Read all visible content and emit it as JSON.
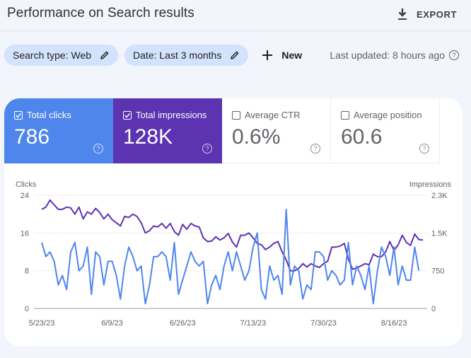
{
  "header": {
    "title": "Performance on Search results",
    "export_label": "EXPORT"
  },
  "filters": {
    "chips": [
      {
        "label": "Search type: Web"
      },
      {
        "label": "Date: Last 3 months"
      }
    ],
    "new_label": "New",
    "last_updated": "Last updated: 8 hours ago"
  },
  "metrics": [
    {
      "label": "Total clicks",
      "value": "786",
      "checked": true,
      "color": "#4f86ec"
    },
    {
      "label": "Total impressions",
      "value": "128K",
      "checked": true,
      "color": "#5c33b0"
    },
    {
      "label": "Average CTR",
      "value": "0.6%",
      "checked": false
    },
    {
      "label": "Average position",
      "value": "60.6",
      "checked": false
    }
  ],
  "chart_data": {
    "type": "line",
    "left_axis": {
      "label": "Clicks",
      "ticks": [
        "24",
        "16",
        "8",
        "0"
      ],
      "range": [
        0,
        24
      ]
    },
    "right_axis": {
      "label": "Impressions",
      "ticks": [
        "2.3K",
        "1.5K",
        "750",
        "0"
      ],
      "range": [
        0,
        2250
      ]
    },
    "x_tick_labels": [
      "5/23/23",
      "6/9/23",
      "6/26/23",
      "7/13/23",
      "7/30/23",
      "8/16/23"
    ],
    "x_start": "5/23/23",
    "tick_interval_days": 17,
    "grid": true,
    "series": [
      {
        "name": "Clicks",
        "axis": "left",
        "color": "#4f86ec",
        "values": [
          14,
          11,
          12,
          10,
          5,
          7,
          4,
          12,
          14,
          8,
          9,
          13,
          3,
          12,
          11,
          5,
          10,
          10,
          7,
          2,
          9,
          13,
          11,
          8,
          9,
          1,
          5,
          11,
          11,
          12,
          11,
          6,
          14,
          3,
          6,
          9,
          12,
          10,
          9,
          10,
          1,
          5,
          7,
          4,
          9,
          12,
          8,
          12,
          9,
          6,
          8,
          13,
          16,
          4,
          2,
          9,
          6,
          7,
          3,
          21,
          5,
          9,
          8,
          2,
          5,
          4,
          12,
          12,
          11,
          6,
          8,
          7,
          5,
          6,
          14,
          5,
          9,
          7,
          4,
          9,
          1,
          8,
          13,
          11,
          7,
          13,
          5,
          9,
          6,
          6,
          13,
          8
        ]
      },
      {
        "name": "Impressions",
        "axis": "right",
        "color": "#5c33b0",
        "values": [
          1970,
          2015,
          2155,
          2060,
          1970,
          1970,
          2015,
          2000,
          1875,
          2015,
          1780,
          1920,
          1875,
          1990,
          1905,
          1780,
          1875,
          1765,
          1705,
          1640,
          1830,
          1810,
          1875,
          1830,
          1705,
          1500,
          1545,
          1640,
          1620,
          1690,
          1595,
          1690,
          1530,
          1455,
          1670,
          1575,
          1690,
          1640,
          1620,
          1405,
          1330,
          1340,
          1425,
          1360,
          1405,
          1490,
          1320,
          1220,
          1455,
          1455,
          1500,
          1405,
          1295,
          1265,
          1170,
          1220,
          1295,
          1330,
          1125,
          965,
          750,
          750,
          795,
          890,
          825,
          890,
          845,
          815,
          890,
          940,
          1220,
          1220,
          1240,
          1295,
          985,
          780,
          805,
          845,
          890,
          870,
          1080,
          1030,
          1030,
          1125,
          1330,
          1155,
          1265,
          1455,
          1310,
          1255,
          1480,
          1370,
          1360
        ]
      }
    ]
  }
}
